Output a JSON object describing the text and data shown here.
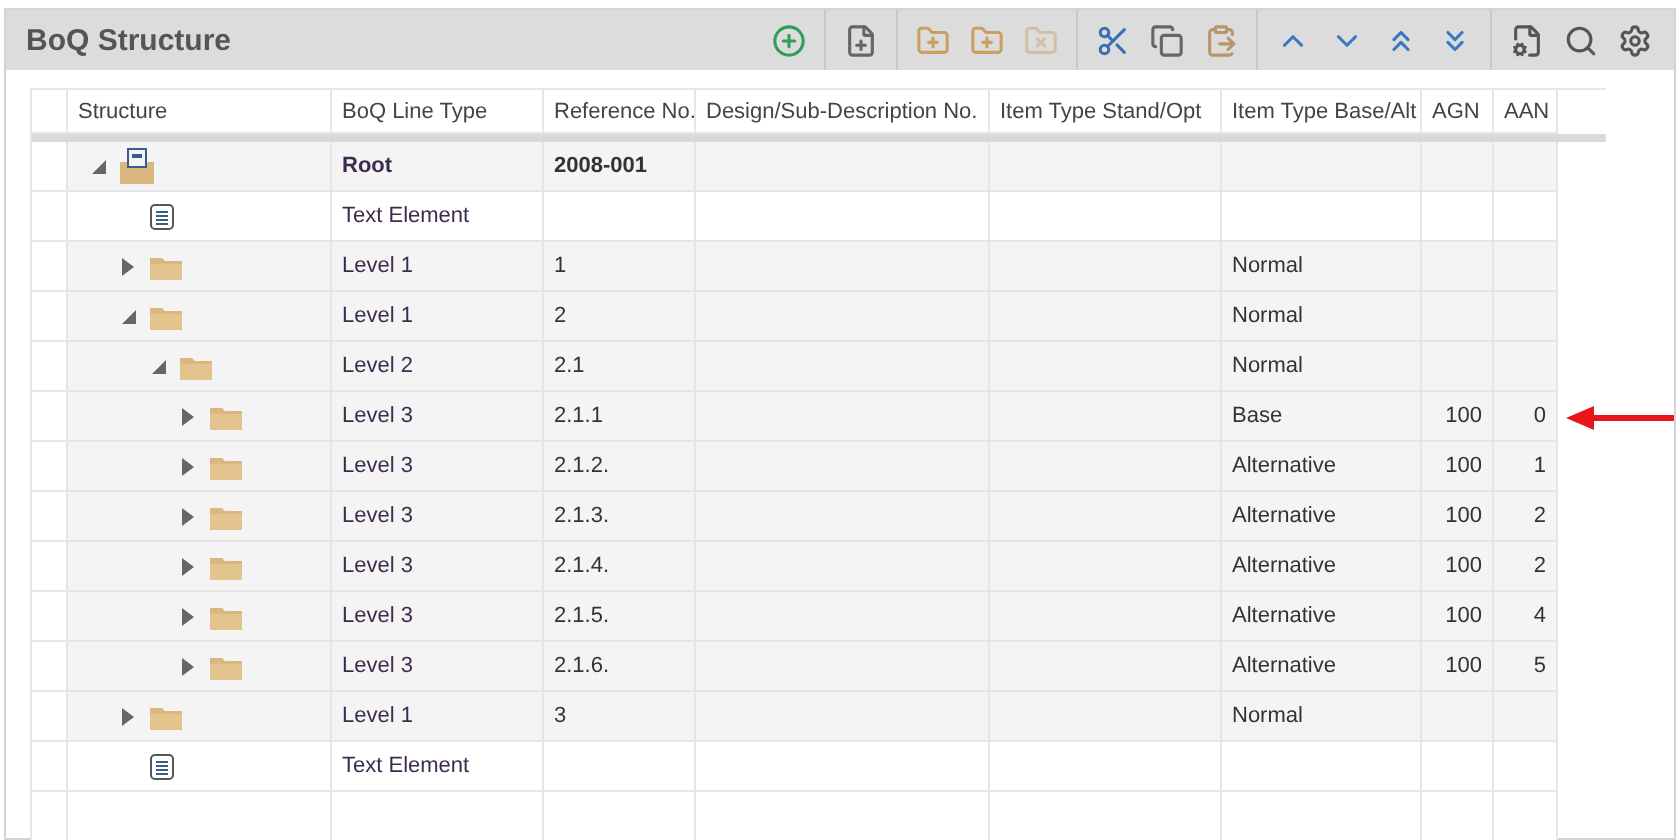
{
  "panel": {
    "title": "BoQ Structure"
  },
  "toolbar": [
    {
      "kind": "add",
      "disabled": false
    },
    {
      "kind": "sep"
    },
    {
      "kind": "new-record",
      "disabled": false
    },
    {
      "kind": "sep"
    },
    {
      "kind": "folder-add",
      "disabled": false
    },
    {
      "kind": "subfolder-add",
      "disabled": false
    },
    {
      "kind": "folder-delete",
      "disabled": true
    },
    {
      "kind": "sep"
    },
    {
      "kind": "cut",
      "disabled": false
    },
    {
      "kind": "copy",
      "disabled": false
    },
    {
      "kind": "paste",
      "disabled": false
    },
    {
      "kind": "sep"
    },
    {
      "kind": "up",
      "disabled": false
    },
    {
      "kind": "down",
      "disabled": false
    },
    {
      "kind": "top",
      "disabled": false
    },
    {
      "kind": "bottom",
      "disabled": false
    },
    {
      "kind": "sep"
    },
    {
      "kind": "doc-settings",
      "disabled": false
    },
    {
      "kind": "search",
      "disabled": false
    },
    {
      "kind": "settings",
      "disabled": false
    }
  ],
  "table": {
    "columns": [
      "Structure",
      "BoQ Line Type",
      "Reference No.",
      "Design/Sub-Description No.",
      "Item Type Stand/Opt",
      "Item Type Base/Alt",
      "AGN",
      "AAN"
    ],
    "rows": [
      {
        "kind": "root",
        "expanded": true,
        "line_type": "Root",
        "reference": "2008-001",
        "children": [
          {
            "kind": "text",
            "line_type": "Text Element"
          },
          {
            "kind": "folder",
            "expanded": false,
            "line_type": "Level 1",
            "reference": "1",
            "base_alt": "Normal"
          },
          {
            "kind": "folder",
            "expanded": true,
            "line_type": "Level 1",
            "reference": "2",
            "base_alt": "Normal",
            "children": [
              {
                "kind": "folder",
                "expanded": true,
                "line_type": "Level 2",
                "reference": "2.1",
                "base_alt": "Normal",
                "children": [
                  {
                    "kind": "folder",
                    "expanded": false,
                    "line_type": "Level 3",
                    "reference": "2.1.1",
                    "base_alt": "Base",
                    "agn": "100",
                    "aan": "0",
                    "marked": true
                  },
                  {
                    "kind": "folder",
                    "expanded": false,
                    "line_type": "Level 3",
                    "reference": "2.1.2.",
                    "base_alt": "Alternative",
                    "agn": "100",
                    "aan": "1"
                  },
                  {
                    "kind": "folder",
                    "expanded": false,
                    "line_type": "Level 3",
                    "reference": "2.1.3.",
                    "base_alt": "Alternative",
                    "agn": "100",
                    "aan": "2"
                  },
                  {
                    "kind": "folder",
                    "expanded": false,
                    "line_type": "Level 3",
                    "reference": "2.1.4.",
                    "base_alt": "Alternative",
                    "agn": "100",
                    "aan": "2"
                  },
                  {
                    "kind": "folder",
                    "expanded": false,
                    "line_type": "Level 3",
                    "reference": "2.1.5.",
                    "base_alt": "Alternative",
                    "agn": "100",
                    "aan": "4"
                  },
                  {
                    "kind": "folder",
                    "expanded": false,
                    "line_type": "Level 3",
                    "reference": "2.1.6.",
                    "base_alt": "Alternative",
                    "agn": "100",
                    "aan": "5"
                  }
                ]
              }
            ]
          },
          {
            "kind": "folder",
            "expanded": false,
            "line_type": "Level 1",
            "reference": "3",
            "base_alt": "Normal"
          },
          {
            "kind": "text",
            "line_type": "Text Element"
          }
        ]
      }
    ]
  }
}
